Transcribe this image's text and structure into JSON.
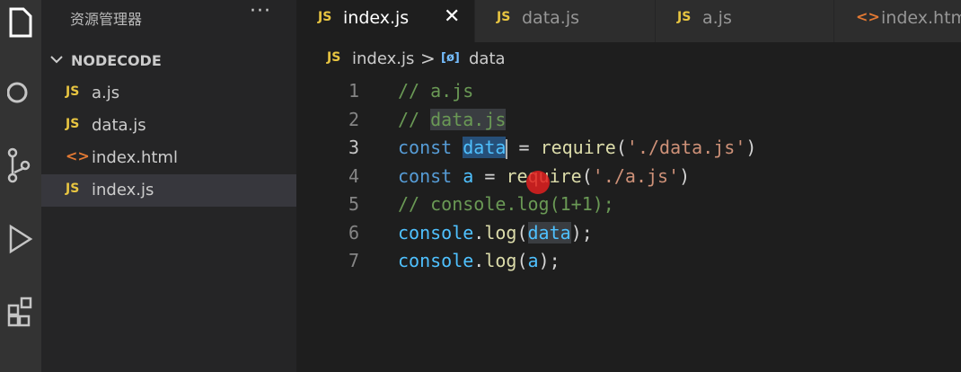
{
  "sidebar": {
    "title": "资源管理器",
    "more": "···",
    "folder": "NODECODE",
    "files": [
      {
        "icon": "JS",
        "name": "a.js"
      },
      {
        "icon": "JS",
        "name": "data.js"
      },
      {
        "icon": "<>",
        "name": "index.html"
      },
      {
        "icon": "JS",
        "name": "index.js"
      }
    ]
  },
  "tabs": [
    {
      "icon": "JS",
      "label": "index.js",
      "close": "✕"
    },
    {
      "icon": "JS",
      "label": "data.js"
    },
    {
      "icon": "JS",
      "label": "a.js"
    },
    {
      "icon": "<>",
      "label": "index.htm"
    }
  ],
  "breadcrumb": {
    "icon": "JS",
    "file": "index.js",
    "separator": ">",
    "symbol_icon": "[ø]",
    "symbol": "data"
  },
  "editor": {
    "line_numbers": [
      "1",
      "2",
      "3",
      "4",
      "5",
      "6",
      "7"
    ],
    "lines": {
      "l1": "// a.js",
      "l2a": "// ",
      "l2b": "data.js",
      "l3_const": "const",
      "l3_var": "data",
      "l3_eq": " = ",
      "l3_fn": "require",
      "l3_open": "(",
      "l3_str": "'./data.js'",
      "l3_close": ")",
      "l4_const": "const",
      "l4_var": " a",
      "l4_eq": " = ",
      "l4_fn": "require",
      "l4_open": "(",
      "l4_str": "'./a.js'",
      "l4_close": ")",
      "l5": "// console.log(1+1);",
      "l6_obj": "console",
      "l6_dot": ".",
      "l6_fn": "log",
      "l6_open": "(",
      "l6_arg": "data",
      "l6_close": ");",
      "l7_obj": "console",
      "l7_dot": ".",
      "l7_fn": "log",
      "l7_open": "(",
      "l7_arg": "a",
      "l7_close": ");"
    }
  },
  "icons": {
    "explorer": "files-icon",
    "search": "search-icon",
    "scm": "source-control-icon",
    "debug": "run-debug-icon",
    "extensions": "extensions-icon"
  },
  "colors": {
    "accent": "#264f78",
    "js_icon": "#e8c541",
    "html_icon": "#e37933",
    "mouse_indicator": "#e02020"
  }
}
